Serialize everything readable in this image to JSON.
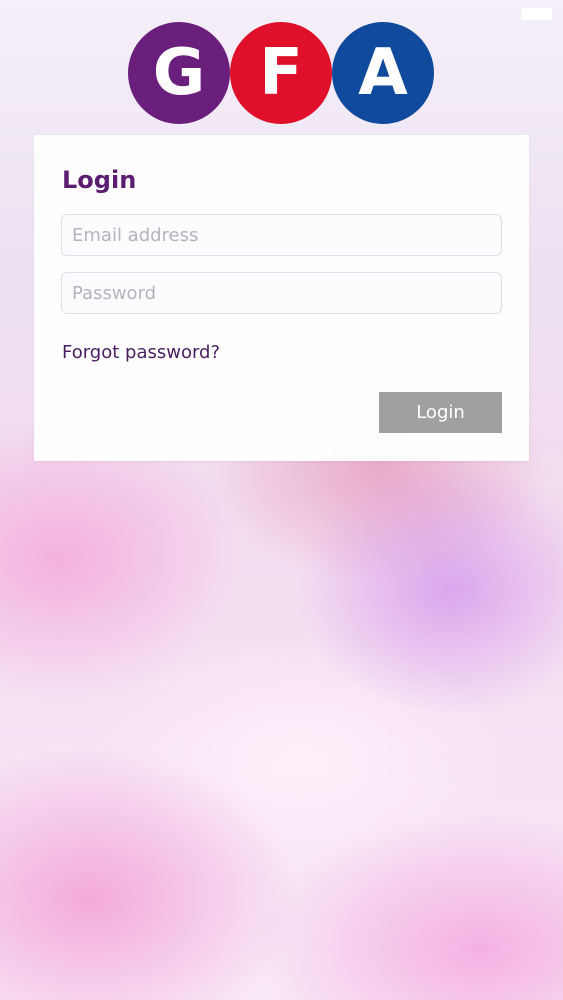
{
  "logo": {
    "letters": [
      "G",
      "F",
      "A"
    ],
    "colors": [
      "#6a1f7d",
      "#e0102a",
      "#0f4a9c"
    ]
  },
  "login": {
    "title": "Login",
    "email_placeholder": "Email address",
    "email_value": "",
    "password_placeholder": "Password",
    "password_value": "",
    "forgot_label": "Forgot password?",
    "button_label": "Login"
  },
  "colors": {
    "title": "#5b1d6f",
    "link": "#4a1d63",
    "button_bg": "#a09fa2"
  }
}
